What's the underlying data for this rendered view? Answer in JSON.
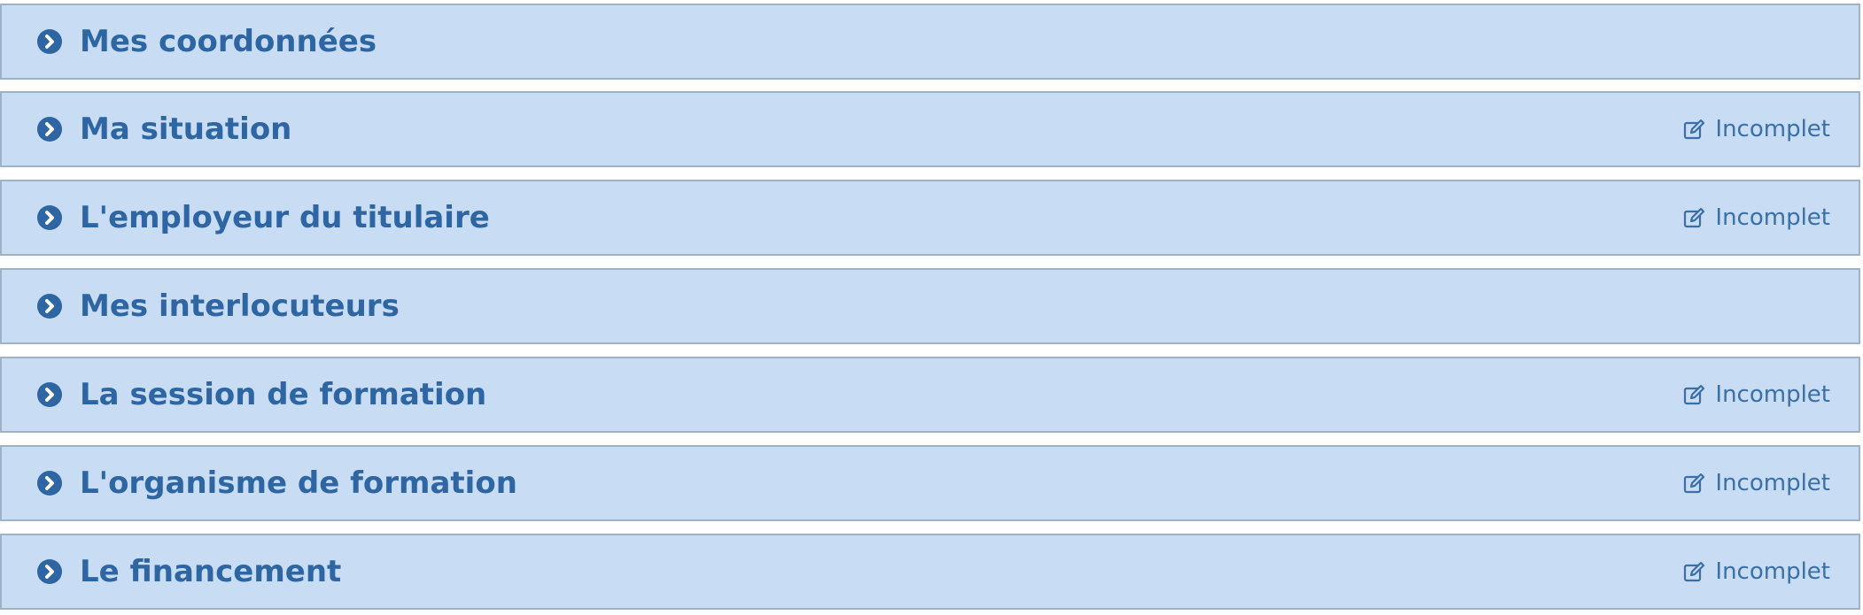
{
  "accent_color": "#2e65a3",
  "panel_background": "#c8dcf3",
  "panel_border": "#9fb1c4",
  "sections": [
    {
      "title": "Mes coordonnées",
      "status": ""
    },
    {
      "title": "Ma situation",
      "status": "Incomplet",
      "status_icon": "edit-icon"
    },
    {
      "title": "L'employeur du titulaire",
      "status": "Incomplet",
      "status_icon": "edit-icon"
    },
    {
      "title": "Mes interlocuteurs",
      "status": ""
    },
    {
      "title": "La session de formation",
      "status": "Incomplet",
      "status_icon": "edit-icon"
    },
    {
      "title": "L'organisme de formation",
      "status": "Incomplet",
      "status_icon": "edit-icon"
    },
    {
      "title": "Le financement",
      "status": "Incomplet",
      "status_icon": "edit-icon"
    }
  ]
}
